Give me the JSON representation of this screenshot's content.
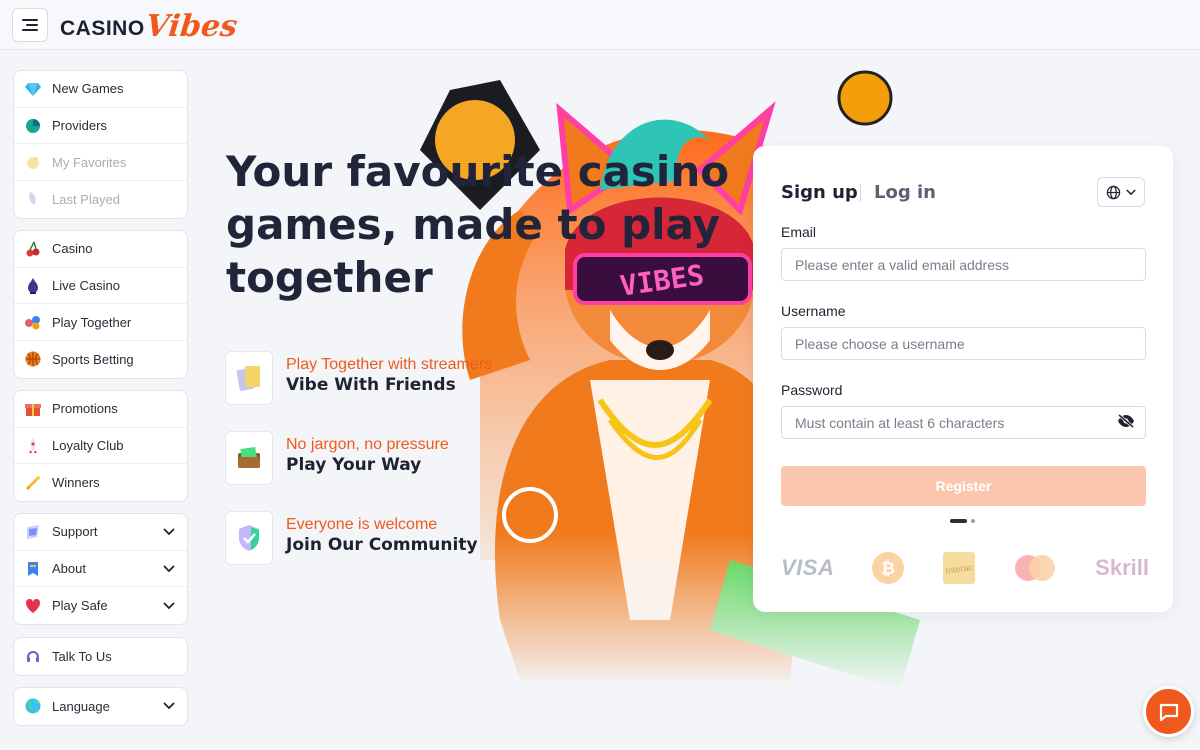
{
  "header": {
    "logo_part1": "CASINO",
    "logo_part2": "Vibes",
    "menu_icon": "hamburger-menu-icon"
  },
  "sidebar": {
    "group1": [
      {
        "label": "New Games",
        "icon": "diamond-icon",
        "state": "normal"
      },
      {
        "label": "Providers",
        "icon": "providers-icon",
        "state": "normal"
      },
      {
        "label": "My Favorites",
        "icon": "favorites-icon",
        "state": "disabled"
      },
      {
        "label": "Last Played",
        "icon": "history-icon",
        "state": "disabled"
      }
    ],
    "group2": [
      {
        "label": "Casino",
        "icon": "cherry-icon"
      },
      {
        "label": "Live Casino",
        "icon": "live-casino-icon"
      },
      {
        "label": "Play Together",
        "icon": "play-together-icon"
      },
      {
        "label": "Sports Betting",
        "icon": "basketball-icon"
      }
    ],
    "group3": [
      {
        "label": "Promotions",
        "icon": "gift-icon"
      },
      {
        "label": "Loyalty Club",
        "icon": "rocket-icon"
      },
      {
        "label": "Winners",
        "icon": "trophy-icon"
      }
    ],
    "group4": [
      {
        "label": "Support",
        "icon": "support-icon"
      },
      {
        "label": "About",
        "icon": "info-icon"
      },
      {
        "label": "Play Safe",
        "icon": "heart-icon"
      }
    ],
    "talk": {
      "label": "Talk To Us",
      "icon": "headset-icon"
    },
    "language": {
      "label": "Language",
      "icon": "globe-icon"
    }
  },
  "hero": {
    "title_line1": "Your favourite casino",
    "title_line2": "games, made to play",
    "title_line3": "together",
    "features": [
      {
        "sub": "Play Together with streamers",
        "main": "Vibe With Friends",
        "icon": "cards-icon"
      },
      {
        "sub": "No jargon, no pressure",
        "main": "Play Your Way",
        "icon": "wallet-icon"
      },
      {
        "sub": "Everyone is welcome",
        "main": "Join Our Community",
        "icon": "shield-check-icon"
      }
    ]
  },
  "form": {
    "tab_signup": "Sign up",
    "tab_login": "Log in",
    "email_label": "Email",
    "email_placeholder": "Please enter a valid email address",
    "username_label": "Username",
    "username_placeholder": "Please choose a username",
    "password_label": "Password",
    "password_placeholder": "Must contain at least 6 characters",
    "register_label": "Register",
    "payments": [
      "VISA",
      "bitcoin-icon",
      "interac-icon",
      "mastercard-icon",
      "Skrill"
    ]
  },
  "colors": {
    "accent": "#ef5a1c",
    "register_disabled": "#fbc6ae",
    "text_dark": "#1f2230",
    "background": "#f4f5f8"
  }
}
